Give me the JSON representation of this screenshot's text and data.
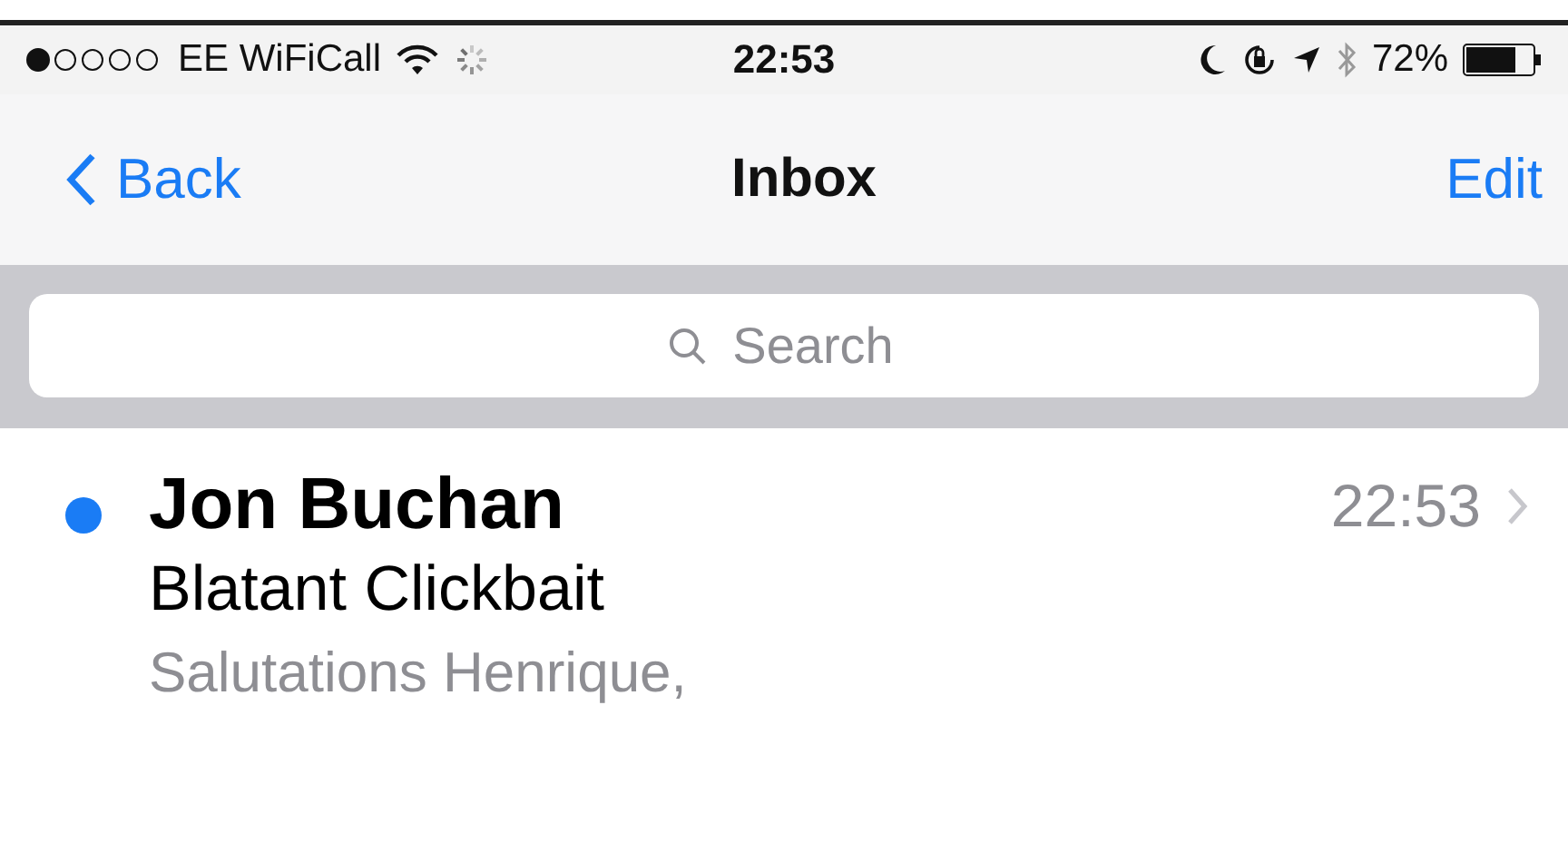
{
  "status_bar": {
    "carrier": "EE WiFiCall",
    "time": "22:53",
    "battery": "72%"
  },
  "nav_bar": {
    "back": "Back",
    "title": "Inbox",
    "action": "Edit"
  },
  "search": {
    "placeholder": "Search"
  },
  "messages": [
    {
      "sender": "Jon Buchan",
      "subject": "Blatant Clickbait",
      "preview": "Salutations Henrique,",
      "time": "22:53",
      "unread": true
    }
  ]
}
